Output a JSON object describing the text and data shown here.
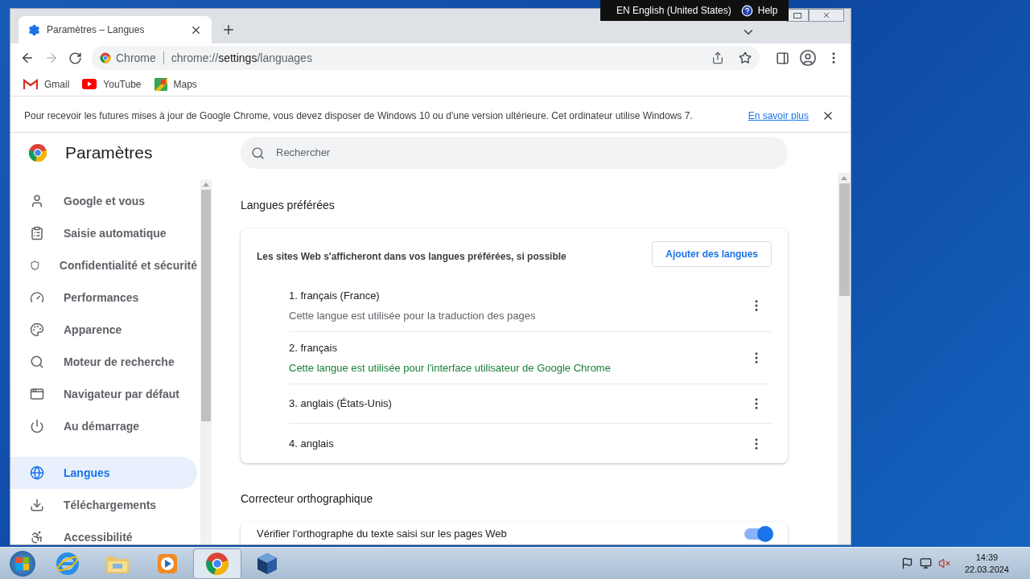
{
  "language_bar": {
    "language": "EN English (United States)",
    "help": "Help"
  },
  "tab": {
    "title": "Paramètres – Langues",
    "selected": true
  },
  "address_bar": {
    "site": "Chrome",
    "url_prefix": "chrome://",
    "url_host": "settings",
    "url_path": "/languages"
  },
  "bookmarks": [
    {
      "label": "Gmail",
      "kind": "gmail"
    },
    {
      "label": "YouTube",
      "kind": "youtube"
    },
    {
      "label": "Maps",
      "kind": "maps"
    }
  ],
  "infobar": {
    "message": "Pour recevoir les futures mises à jour de Google Chrome, vous devez disposer de Windows 10 ou d'une version ultérieure. Cet ordinateur utilise Windows 7.",
    "link": "En savoir plus"
  },
  "settings_title": "Paramètres",
  "search": {
    "placeholder": "Rechercher"
  },
  "sidebar_items": [
    {
      "label": "Google et vous",
      "kind": "person",
      "selected": false
    },
    {
      "label": "Saisie automatique",
      "kind": "clipboard",
      "selected": false
    },
    {
      "label": "Confidentialité et sécurité",
      "kind": "shield",
      "selected": false
    },
    {
      "label": "Performances",
      "kind": "gauge",
      "selected": false
    },
    {
      "label": "Apparence",
      "kind": "palette",
      "selected": false
    },
    {
      "label": "Moteur de recherche",
      "kind": "search",
      "selected": false
    },
    {
      "label": "Navigateur par défaut",
      "kind": "browser",
      "selected": false
    },
    {
      "label": "Au démarrage",
      "kind": "power",
      "selected": false
    },
    {
      "label": "Langues",
      "kind": "globe",
      "selected": true
    },
    {
      "label": "Téléchargements",
      "kind": "download",
      "selected": false
    },
    {
      "label": "Accessibilité",
      "kind": "accessibility",
      "selected": false
    }
  ],
  "preferred_languages": {
    "heading": "Langues préférées",
    "description": "Les sites Web s'afficheront dans vos langues préférées, si possible",
    "add_button": "Ajouter des langues",
    "languages": [
      {
        "name": "1. français (France)",
        "note": {
          "text": "Cette langue est utilisée pour la traduction des pages",
          "color": "#5f6368"
        }
      },
      {
        "name": "2. français",
        "note": {
          "text": "Cette langue est utilisée pour l'interface utilisateur de Google Chrome",
          "color": "#188038"
        }
      },
      {
        "name": "3. anglais (États-Unis)"
      },
      {
        "name": "4. anglais"
      }
    ]
  },
  "spellcheck": {
    "heading": "Correcteur orthographique",
    "label": "Vérifier l'orthographe du texte saisi sur les pages Web",
    "on": true
  },
  "taskbar": {
    "apps": [
      {
        "kind": "ie",
        "selected": false
      },
      {
        "kind": "explorer",
        "selected": false
      },
      {
        "kind": "media",
        "selected": false
      },
      {
        "kind": "chrome",
        "selected": true
      },
      {
        "kind": "virtualbox",
        "selected": false
      }
    ],
    "time": "14:39",
    "date": "22.03.2024"
  }
}
